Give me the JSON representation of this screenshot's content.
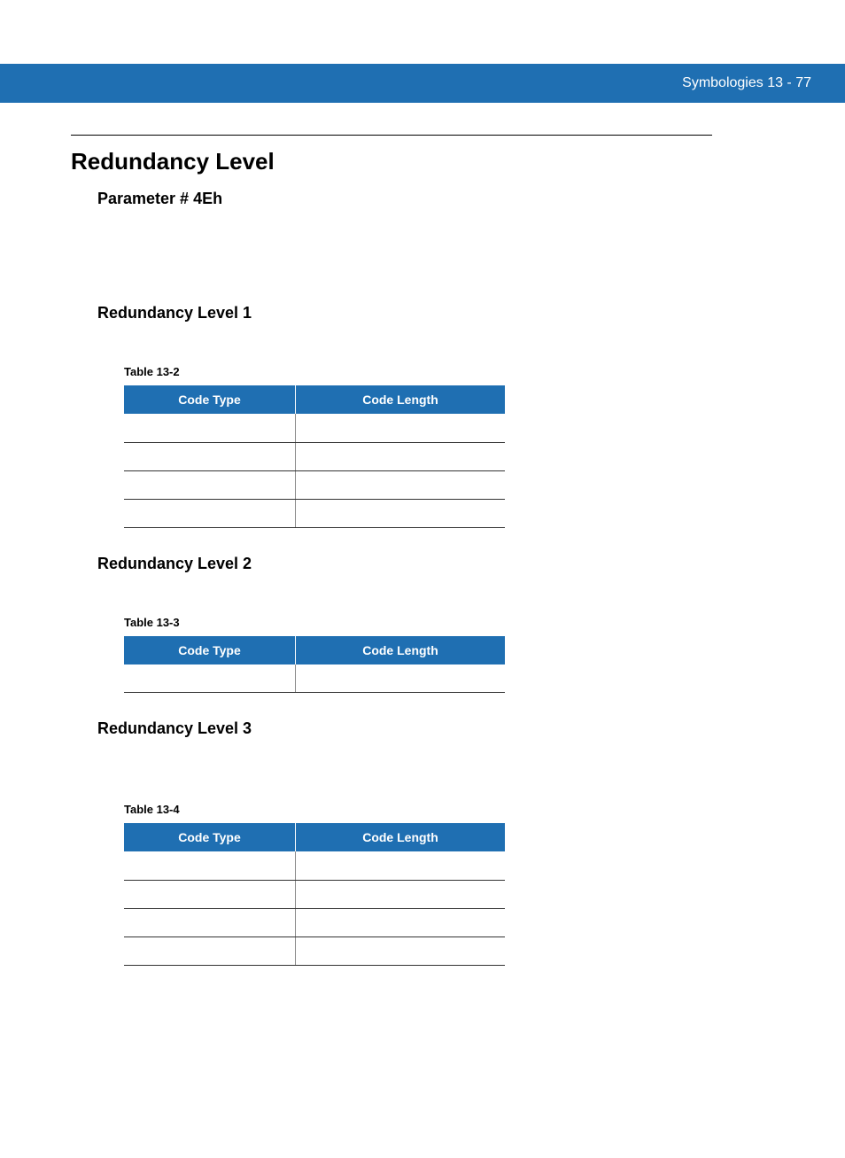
{
  "header": {
    "text": "Symbologies 13 - 77"
  },
  "title": "Redundancy Level",
  "parameter_heading": "Parameter # 4Eh",
  "sections": [
    {
      "heading": "Redundancy Level 1",
      "table_caption": "Table 13-2",
      "columns": [
        "Code Type",
        "Code Length"
      ],
      "rows": [
        [
          "",
          ""
        ],
        [
          "",
          ""
        ],
        [
          "",
          ""
        ],
        [
          "",
          ""
        ]
      ]
    },
    {
      "heading": "Redundancy Level 2",
      "table_caption": "Table 13-3",
      "columns": [
        "Code Type",
        "Code Length"
      ],
      "rows": [
        [
          "",
          ""
        ]
      ]
    },
    {
      "heading": "Redundancy Level 3",
      "table_caption": "Table 13-4",
      "columns": [
        "Code Type",
        "Code Length"
      ],
      "rows": [
        [
          "",
          ""
        ],
        [
          "",
          ""
        ],
        [
          "",
          ""
        ],
        [
          "",
          ""
        ]
      ]
    }
  ]
}
